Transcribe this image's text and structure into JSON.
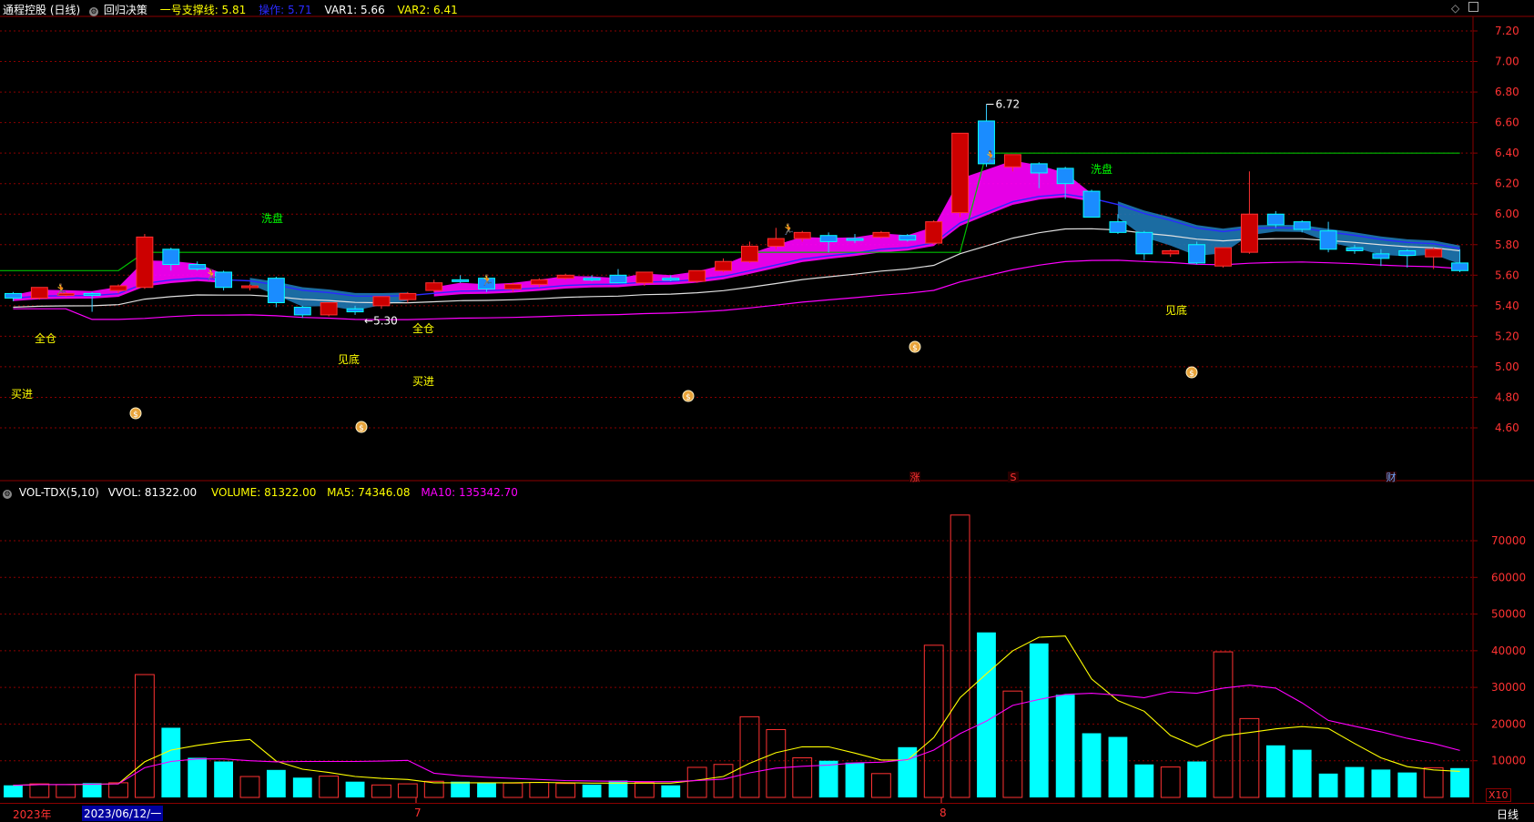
{
  "header": {
    "title": "通程控股 (日线)",
    "indicator_name": "回归决策",
    "support_label": "一号支撑线: 5.81",
    "operate_label": "操作: 5.71",
    "var1_label": "VAR1: 5.66",
    "var2_label": "VAR2: 6.41"
  },
  "volume_header": {
    "name": "VOL-TDX(5,10)",
    "vvol": "VVOL: 81322.00",
    "volume": "VOLUME: 81322.00",
    "ma5": "MA5: 74346.08",
    "ma10": "MA10: 135342.70"
  },
  "footer": {
    "year": "2023年",
    "cursor_date": "2023/06/12/一",
    "month_7": "7",
    "month_8": "8",
    "period": "日线",
    "multiplier": "X10"
  },
  "price_axis": {
    "ticks": [
      "7.20",
      "7.00",
      "6.80",
      "6.60",
      "6.40",
      "6.20",
      "6.00",
      "5.80",
      "5.60",
      "5.40",
      "5.20",
      "5.00",
      "4.80",
      "4.60"
    ]
  },
  "volume_axis": {
    "ticks": [
      "70000",
      "60000",
      "50000",
      "40000",
      "30000",
      "20000",
      "10000"
    ]
  },
  "annotations": {
    "max_price": "6.72",
    "min_price": "←5.30",
    "buy_in_1": "买进",
    "buy_in_2": "买进",
    "full_pos_1": "全仓",
    "full_pos_2": "全仓",
    "bottom_1": "见底",
    "bottom_2": "见底",
    "wash_1": "洗盘",
    "wash_2": "洗盘",
    "rise_marker": "涨",
    "s_marker": "S",
    "fin_marker": "财"
  },
  "colors": {
    "up": "#ff3232",
    "down": "#00ffff",
    "ma5": "#ffff00",
    "ma10": "#ff00ff",
    "support": "#00c000",
    "grid": "#8b0000"
  },
  "chart_data": [
    {
      "type": "candlestick",
      "title": "通程控股 (日线)",
      "ylim": [
        4.5,
        7.3
      ],
      "ohlc": [
        [
          5.48,
          5.49,
          5.43,
          5.45
        ],
        [
          5.45,
          5.52,
          5.44,
          5.52
        ],
        [
          5.48,
          5.49,
          5.46,
          5.48
        ],
        [
          5.48,
          5.49,
          5.36,
          5.47
        ],
        [
          5.5,
          5.54,
          5.48,
          5.53
        ],
        [
          5.52,
          5.87,
          5.51,
          5.85
        ],
        [
          5.77,
          5.78,
          5.63,
          5.67
        ],
        [
          5.67,
          5.69,
          5.63,
          5.64
        ],
        [
          5.62,
          5.63,
          5.5,
          5.52
        ],
        [
          5.52,
          5.54,
          5.5,
          5.53
        ],
        [
          5.58,
          5.59,
          5.39,
          5.42
        ],
        [
          5.39,
          5.4,
          5.32,
          5.34
        ],
        [
          5.34,
          5.42,
          5.33,
          5.42
        ],
        [
          5.38,
          5.4,
          5.34,
          5.36
        ],
        [
          5.4,
          5.46,
          5.38,
          5.46
        ],
        [
          5.44,
          5.49,
          5.42,
          5.48
        ],
        [
          5.5,
          5.57,
          5.49,
          5.55
        ],
        [
          5.57,
          5.6,
          5.55,
          5.56
        ],
        [
          5.58,
          5.59,
          5.49,
          5.51
        ],
        [
          5.51,
          5.55,
          5.49,
          5.54
        ],
        [
          5.54,
          5.58,
          5.52,
          5.57
        ],
        [
          5.58,
          5.61,
          5.57,
          5.6
        ],
        [
          5.58,
          5.6,
          5.56,
          5.57
        ],
        [
          5.6,
          5.64,
          5.55,
          5.55
        ],
        [
          5.55,
          5.62,
          5.53,
          5.62
        ],
        [
          5.58,
          5.6,
          5.56,
          5.57
        ],
        [
          5.56,
          5.63,
          5.55,
          5.63
        ],
        [
          5.63,
          5.71,
          5.62,
          5.69
        ],
        [
          5.69,
          5.82,
          5.68,
          5.79
        ],
        [
          5.79,
          5.91,
          5.77,
          5.84
        ],
        [
          5.84,
          5.89,
          5.82,
          5.88
        ],
        [
          5.86,
          5.88,
          5.75,
          5.82
        ],
        [
          5.84,
          5.87,
          5.81,
          5.83
        ],
        [
          5.85,
          5.89,
          5.84,
          5.88
        ],
        [
          5.86,
          5.87,
          5.82,
          5.83
        ],
        [
          5.81,
          5.96,
          5.8,
          5.95
        ],
        [
          6.01,
          6.53,
          5.98,
          6.53
        ],
        [
          6.61,
          6.72,
          6.31,
          6.33
        ],
        [
          6.31,
          6.39,
          6.28,
          6.39
        ],
        [
          6.33,
          6.34,
          6.17,
          6.27
        ],
        [
          6.3,
          6.31,
          6.1,
          6.2
        ],
        [
          6.15,
          6.16,
          5.99,
          5.98
        ],
        [
          5.95,
          6.0,
          5.87,
          5.88
        ],
        [
          5.88,
          5.89,
          5.7,
          5.74
        ],
        [
          5.74,
          5.77,
          5.72,
          5.76
        ],
        [
          5.8,
          5.82,
          5.67,
          5.68
        ],
        [
          5.66,
          5.77,
          5.65,
          5.78
        ],
        [
          5.75,
          6.28,
          5.74,
          6.0
        ],
        [
          6.0,
          6.02,
          5.91,
          5.93
        ],
        [
          5.95,
          5.96,
          5.88,
          5.9
        ],
        [
          5.89,
          5.95,
          5.75,
          5.77
        ],
        [
          5.78,
          5.8,
          5.74,
          5.76
        ],
        [
          5.74,
          5.77,
          5.66,
          5.71
        ],
        [
          5.76,
          5.77,
          5.65,
          5.73
        ],
        [
          5.72,
          5.78,
          5.64,
          5.77
        ],
        [
          5.68,
          5.77,
          5.62,
          5.63
        ]
      ]
    },
    {
      "type": "bar",
      "title": "VOL-TDX(5,10)",
      "ylim": [
        0,
        78000
      ],
      "values": [
        3300,
        3700,
        3500,
        3900,
        4000,
        33500,
        19000,
        10800,
        9800,
        5700,
        7500,
        5400,
        5800,
        4300,
        3400,
        3700,
        4400,
        4300,
        3900,
        3900,
        4100,
        3800,
        3500,
        4600,
        4100,
        3300,
        8200,
        9000,
        22000,
        18500,
        10800,
        10000,
        9500,
        6500,
        13700,
        41500,
        77000,
        45000,
        29000,
        42000,
        28000,
        17500,
        16500,
        9000,
        8300,
        9800,
        39700,
        21500,
        14200,
        13000,
        6500,
        8300,
        7600,
        6800,
        8100,
        8000
      ],
      "series": [
        {
          "name": "MA5",
          "values": [
            3300,
            3500,
            3500,
            3600,
            3700,
            9700,
            12900,
            14200,
            15200,
            15800,
            9900,
            7700,
            6800,
            5700,
            5200,
            4900,
            4000,
            4000,
            4000,
            4000,
            4100,
            4000,
            3900,
            3900,
            3900,
            3900,
            4700,
            5700,
            9300,
            12200,
            13800,
            13800,
            12100,
            10200,
            10200,
            16300,
            27200,
            33700,
            40000,
            43700,
            44000,
            32300,
            26400,
            23500,
            16900,
            13800,
            16800,
            17700,
            18700,
            19300,
            18800,
            14700,
            10800,
            8400,
            7500,
            7100
          ]
        },
        {
          "name": "MA10",
          "values": [
            3300,
            3500,
            3500,
            3600,
            3700,
            8100,
            9800,
            10500,
            10500,
            10000,
            9700,
            9800,
            9800,
            9800,
            9900,
            10100,
            6600,
            5900,
            5500,
            5200,
            4900,
            4600,
            4500,
            4400,
            4300,
            4300,
            4600,
            5000,
            6700,
            8000,
            8500,
            8800,
            9400,
            9600,
            10300,
            12900,
            17400,
            20800,
            25100,
            26700,
            28100,
            28400,
            27900,
            27200,
            28800,
            28400,
            29800,
            30600,
            29800,
            25800,
            21000,
            19400,
            17900,
            16100,
            14700,
            12800
          ]
        }
      ]
    }
  ]
}
